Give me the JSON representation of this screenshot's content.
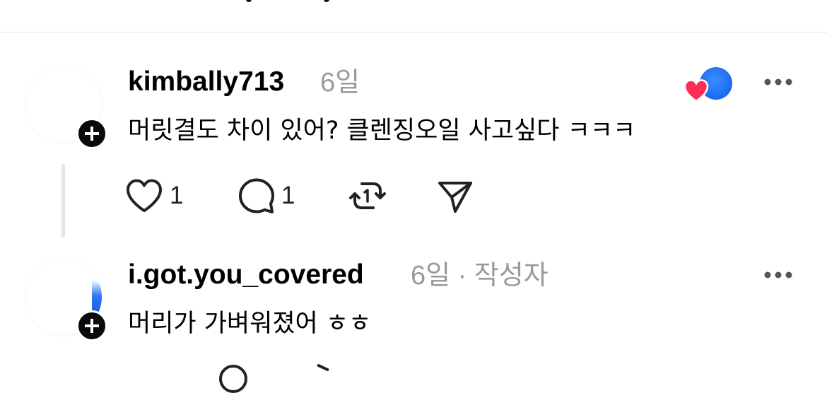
{
  "comments": [
    {
      "username": "kimbally713",
      "time": "6일",
      "author_tag": "",
      "text": "머릿결도 차이 있어? 클렌징오일 사고싶다 ㅋㅋㅋ",
      "likes": "1",
      "replies": "1",
      "reactions": [
        "heart-icon",
        "blue-circle-icon"
      ]
    },
    {
      "username": "i.got.you_covered",
      "time": "6일",
      "author_tag": "· 작성자",
      "text": "머리가 가벼워졌어 ㅎㅎ"
    }
  ],
  "colors": {
    "meta_gray": "#9a9a9a",
    "heart_red": "#ff2d55",
    "accent_blue": "#1f6ff0",
    "divider": "#e4e4e4"
  }
}
